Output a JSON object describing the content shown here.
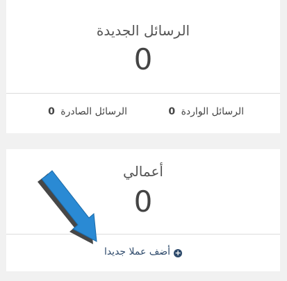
{
  "messages_card": {
    "title": "الرسائل الجديدة",
    "count": "0",
    "inbox_label": "الرسائل الواردة",
    "inbox_count": "0",
    "outbox_label": "الرسائل الصادرة",
    "outbox_count": "0"
  },
  "jobs_card": {
    "title": "أعمالي",
    "count": "0",
    "add_link_label": "أضف عملا جديدا",
    "add_icon": "plus-circle-icon"
  },
  "annotation": {
    "arrow_icon": "pointer-arrow-icon",
    "arrow_color": "#2a8ad4"
  }
}
